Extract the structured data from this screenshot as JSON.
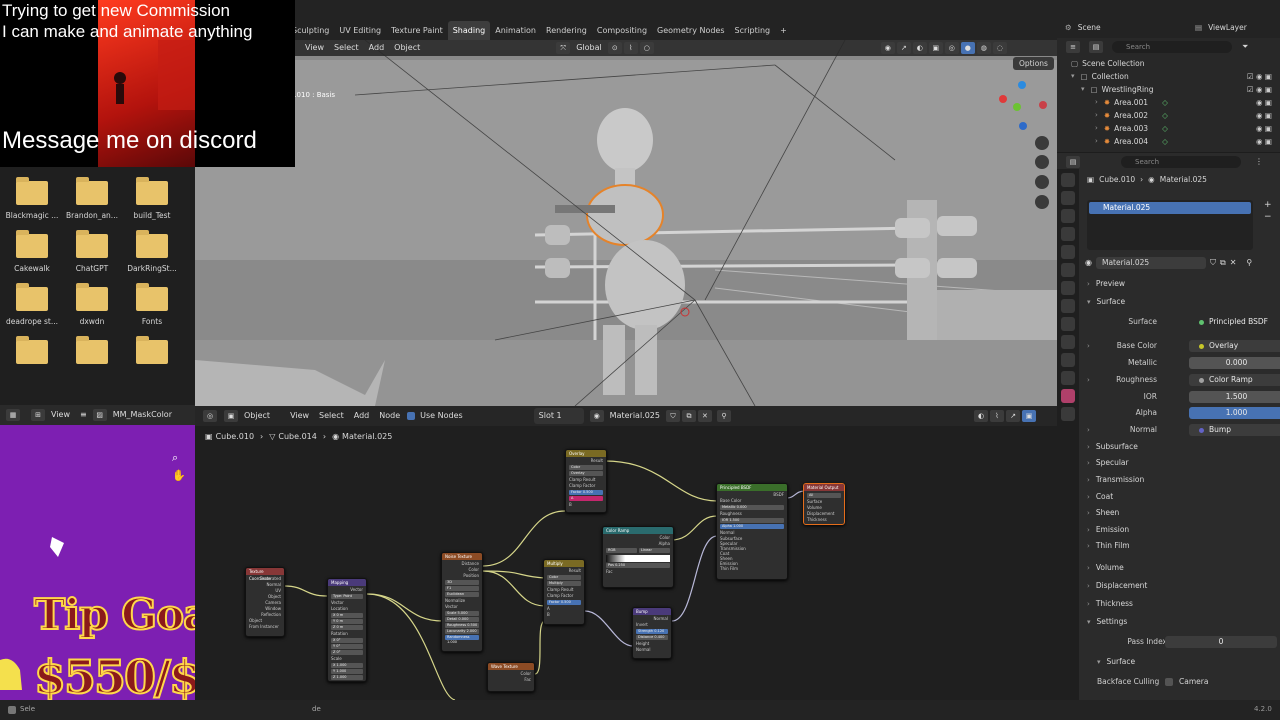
{
  "overlay": {
    "line1": "Trying to get new Commission",
    "line2": "I can make and animate anything",
    "line3": "Message me on discord",
    "tip_line1": "Tip Goal",
    "tip_line2": "$550/$1100"
  },
  "files": [
    {
      "label": "Blackmagic ..."
    },
    {
      "label": "Brandon_an..."
    },
    {
      "label": "build_Test"
    },
    {
      "label": "Cakewalk"
    },
    {
      "label": "ChatGPT"
    },
    {
      "label": "DarkRingSt..."
    },
    {
      "label": "deadrope st..."
    },
    {
      "label": "dxwdn"
    },
    {
      "label": "Fonts"
    },
    {
      "label": ""
    },
    {
      "label": ""
    },
    {
      "label": ""
    }
  ],
  "workspace_tabs": [
    "Sculpting",
    "UV Editing",
    "Texture Paint",
    "Shading",
    "Animation",
    "Rendering",
    "Compositing",
    "Geometry Nodes",
    "Scripting"
  ],
  "active_tab": "Shading",
  "scene": {
    "label": "Scene",
    "view_layer": "ViewLayer"
  },
  "viewport": {
    "menu": [
      "View",
      "Select",
      "Add",
      "Object"
    ],
    "orientation": "Global",
    "options": "Options",
    "object_label": "e.010 : Basis"
  },
  "image_editor": {
    "view": "View",
    "image_name": "MM_MaskColor"
  },
  "node_editor": {
    "mode": "Object",
    "menu": [
      "View",
      "Select",
      "Add",
      "Node"
    ],
    "use_nodes": "Use Nodes",
    "slot": "Slot 1",
    "material": "Material.025",
    "breadcrumb": [
      "Cube.010",
      "Cube.014",
      "Material.025"
    ]
  },
  "nodes": {
    "texcoord": {
      "title": "Texture Coordinate",
      "rows": [
        "Generated",
        "Normal",
        "UV",
        "Object",
        "Camera",
        "Window",
        "Reflection"
      ],
      "object": "Object",
      "from": "From Instancer"
    },
    "mapping": {
      "title": "Mapping",
      "rows": [
        "Vector",
        "Type: Point",
        "Vector",
        "Location",
        "X 0 m",
        "Y 0 m",
        "Z 0 m",
        "Rotation",
        "X 0°",
        "Y 0°",
        "Z 0°",
        "Scale",
        "X 1.000",
        "Y 1.000",
        "Z 1.000"
      ]
    },
    "noise": {
      "title": "Noise Texture",
      "rows": [
        "Distance",
        "Color",
        "Position",
        "3D",
        "F1",
        "Euclidean",
        "Normalize",
        "Vector",
        "Scale 5.000",
        "Detail 0.000",
        "Roughness 0.500",
        "Lacunarity 2.000",
        "Randomness 1.000"
      ]
    },
    "wave": {
      "title": "Wave Texture",
      "rows": [
        "Color",
        "Fac"
      ]
    },
    "overlay": {
      "title": "Overlay",
      "rows": [
        "Result",
        "Color",
        "Overlay",
        "Clamp Result",
        "Clamp Factor",
        "Factor 0.500",
        "A",
        "B"
      ]
    },
    "multiply": {
      "title": "Multiply",
      "rows": [
        "Result",
        "Color",
        "Multiply",
        "Clamp Result",
        "Clamp Factor",
        "Factor 0.500",
        "A",
        "B"
      ]
    },
    "colorramp": {
      "title": "Color Ramp",
      "rows": [
        "Color",
        "Alpha",
        "RGB",
        "Linear",
        "Pos 0.250",
        "Fac"
      ]
    },
    "bump": {
      "title": "Bump",
      "rows": [
        "Normal",
        "Invert",
        "Strength 0.120",
        "Distance 0.400",
        "Height",
        "Normal"
      ]
    },
    "bsdf": {
      "title": "Principled BSDF",
      "rows": [
        "BSDF",
        "Base Color",
        "Metallic 0.000",
        "Roughness",
        "IOR 1.500",
        "Alpha 1.000",
        "Normal",
        "Subsurface",
        "Specular",
        "Transmission",
        "Coat",
        "Sheen",
        "Emission",
        "Thin Film"
      ]
    },
    "output": {
      "title": "Material Output",
      "rows": [
        "All",
        "Surface",
        "Volume",
        "Displacement",
        "Thickness"
      ]
    }
  },
  "outliner": {
    "search": "Search",
    "items": [
      {
        "label": "Scene Collection",
        "indent": 0
      },
      {
        "label": "Collection",
        "indent": 1
      },
      {
        "label": "WrestlingRing",
        "indent": 2
      },
      {
        "label": "Area.001",
        "indent": 3
      },
      {
        "label": "Area.002",
        "indent": 3
      },
      {
        "label": "Area.003",
        "indent": 3
      },
      {
        "label": "Area.004",
        "indent": 3
      }
    ]
  },
  "properties": {
    "search": "Search",
    "object": "Cube.010",
    "material": "Material.025",
    "slot_material": "Material.025",
    "datablock": "Material.025",
    "sections": {
      "preview": "Preview",
      "surface": "Surface",
      "subsurface": "Subsurface",
      "specular": "Specular",
      "transmission": "Transmission",
      "coat": "Coat",
      "sheen": "Sheen",
      "emission": "Emission",
      "thin_film": "Thin Film",
      "volume": "Volume",
      "displacement": "Displacement",
      "thickness": "Thickness",
      "settings": "Settings",
      "surface_sub": "Surface"
    },
    "fields": {
      "surface_label": "Surface",
      "surface_value": "Principled BSDF",
      "base_color_label": "Base Color",
      "base_color_value": "Overlay",
      "metallic_label": "Metallic",
      "metallic_value": "0.000",
      "roughness_label": "Roughness",
      "roughness_value": "Color Ramp",
      "ior_label": "IOR",
      "ior_value": "1.500",
      "alpha_label": "Alpha",
      "alpha_value": "1.000",
      "normal_label": "Normal",
      "normal_value": "Bump",
      "pass_index_label": "Pass Index",
      "pass_index_value": "0",
      "backface_label": "Backface Culling",
      "camera_label": "Camera"
    }
  },
  "status": {
    "version": "4.2.0",
    "left_hint": "Sele",
    "mid_hint": "de"
  },
  "colors": {
    "accent_blue": "#4772b3",
    "image_bg": "#7d1fb2",
    "selection_orange": "#e56d1b"
  }
}
